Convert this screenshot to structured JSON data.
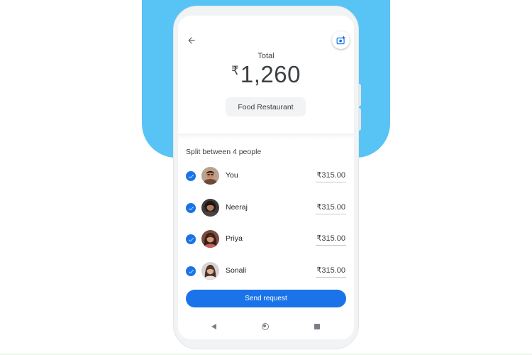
{
  "header": {
    "total_label": "Total",
    "currency_symbol": "₹",
    "total_amount": "1,260",
    "category": "Food Restaurant"
  },
  "split": {
    "heading": "Split between 4 people",
    "people": [
      {
        "name": "You",
        "amount": "₹315.00",
        "checked": true
      },
      {
        "name": "Neeraj",
        "amount": "₹315.00",
        "checked": true
      },
      {
        "name": "Priya",
        "amount": "₹315.00",
        "checked": true
      },
      {
        "name": "Sonali",
        "amount": "₹315.00",
        "checked": true
      }
    ]
  },
  "actions": {
    "send_label": "Send request"
  },
  "icons": {
    "back": "arrow-back-icon",
    "add_photo": "add-photo-icon",
    "check": "check-circle-icon",
    "nav_back": "triangle-back-icon",
    "nav_home": "circle-home-icon",
    "nav_recent": "square-recent-icon"
  },
  "colors": {
    "accent": "#1a73e8",
    "background_shape": "#58c4f5",
    "text_primary": "#3c4043"
  }
}
